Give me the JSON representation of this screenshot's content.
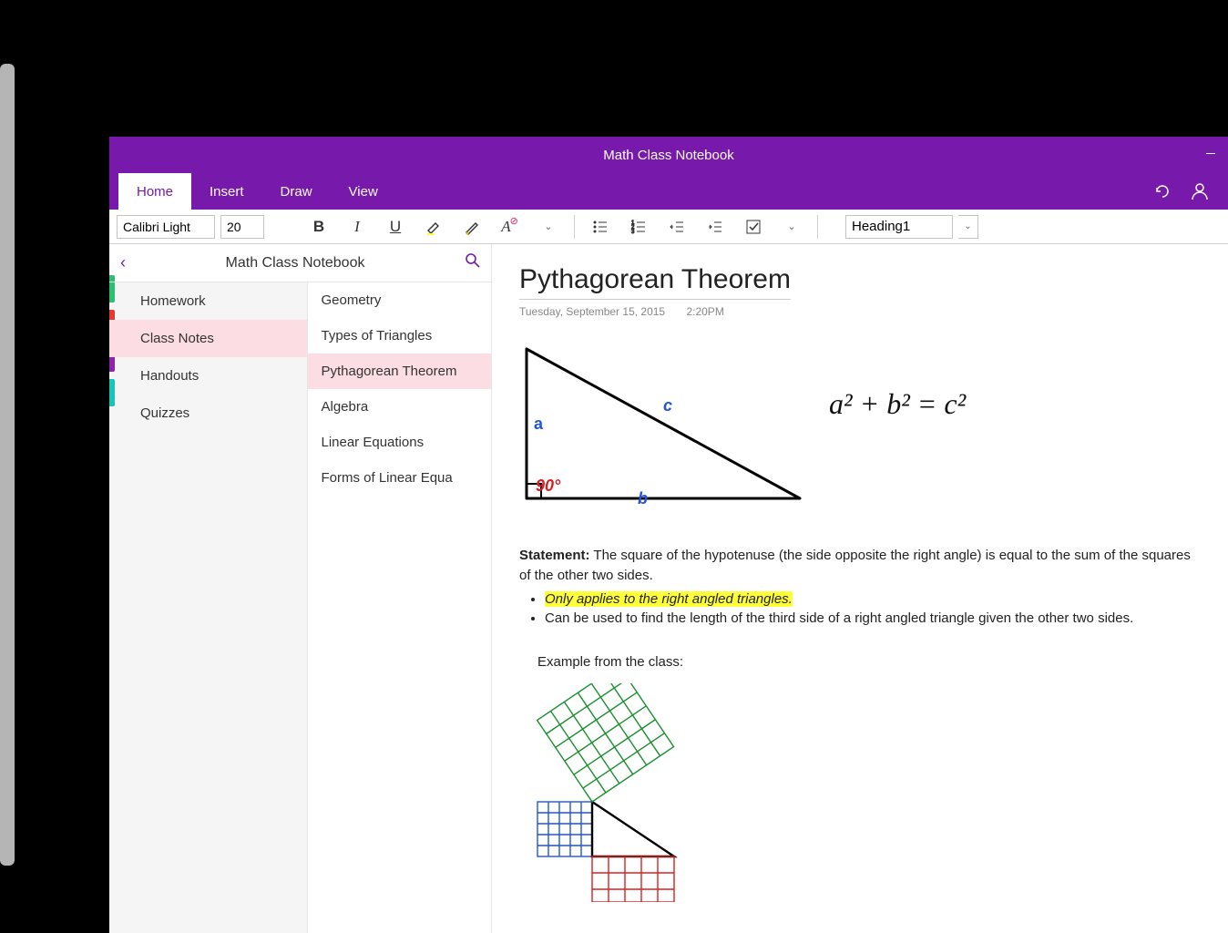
{
  "window": {
    "title": "Math Class Notebook"
  },
  "ribbon": {
    "tabs": [
      "Home",
      "Insert",
      "Draw",
      "View"
    ],
    "active_tab": 0
  },
  "toolbar": {
    "font": "Calibri Light",
    "size": "20",
    "heading_style": "Heading1"
  },
  "nav": {
    "notebook_title": "Math Class Notebook",
    "section_colors": [
      "#2bbf6e",
      "#e53935",
      "#8e24aa",
      "#19c5b6"
    ],
    "sections": [
      {
        "label": "Homework"
      },
      {
        "label": "Class Notes",
        "active": true
      },
      {
        "label": "Handouts"
      },
      {
        "label": "Quizzes"
      }
    ],
    "pages": [
      {
        "label": "Geometry"
      },
      {
        "label": "Types of Triangles"
      },
      {
        "label": "Pythagorean Theorem",
        "active": true
      },
      {
        "label": "Algebra"
      },
      {
        "label": "Linear Equations"
      },
      {
        "label": "Forms of Linear Equa"
      }
    ]
  },
  "note": {
    "title": "Pythagorean Theorem",
    "date": "Tuesday, September 15, 2015",
    "time": "2:20PM",
    "triangle": {
      "label_a": "a",
      "label_b": "b",
      "label_c": "c",
      "angle": "90°"
    },
    "formula": "a² + b² = c²",
    "statement_label": "Statement:",
    "statement_text": " The square of the hypotenuse (the side opposite the right angle) is equal to the sum of the squares of the other two sides.",
    "bullets": [
      {
        "text": "Only applies to the right angled triangles.",
        "highlight": true
      },
      {
        "text": "Can be used to find the length of the third side of a right angled triangle given the other two sides.",
        "highlight": false
      }
    ],
    "example_heading": "Example from the class:"
  }
}
